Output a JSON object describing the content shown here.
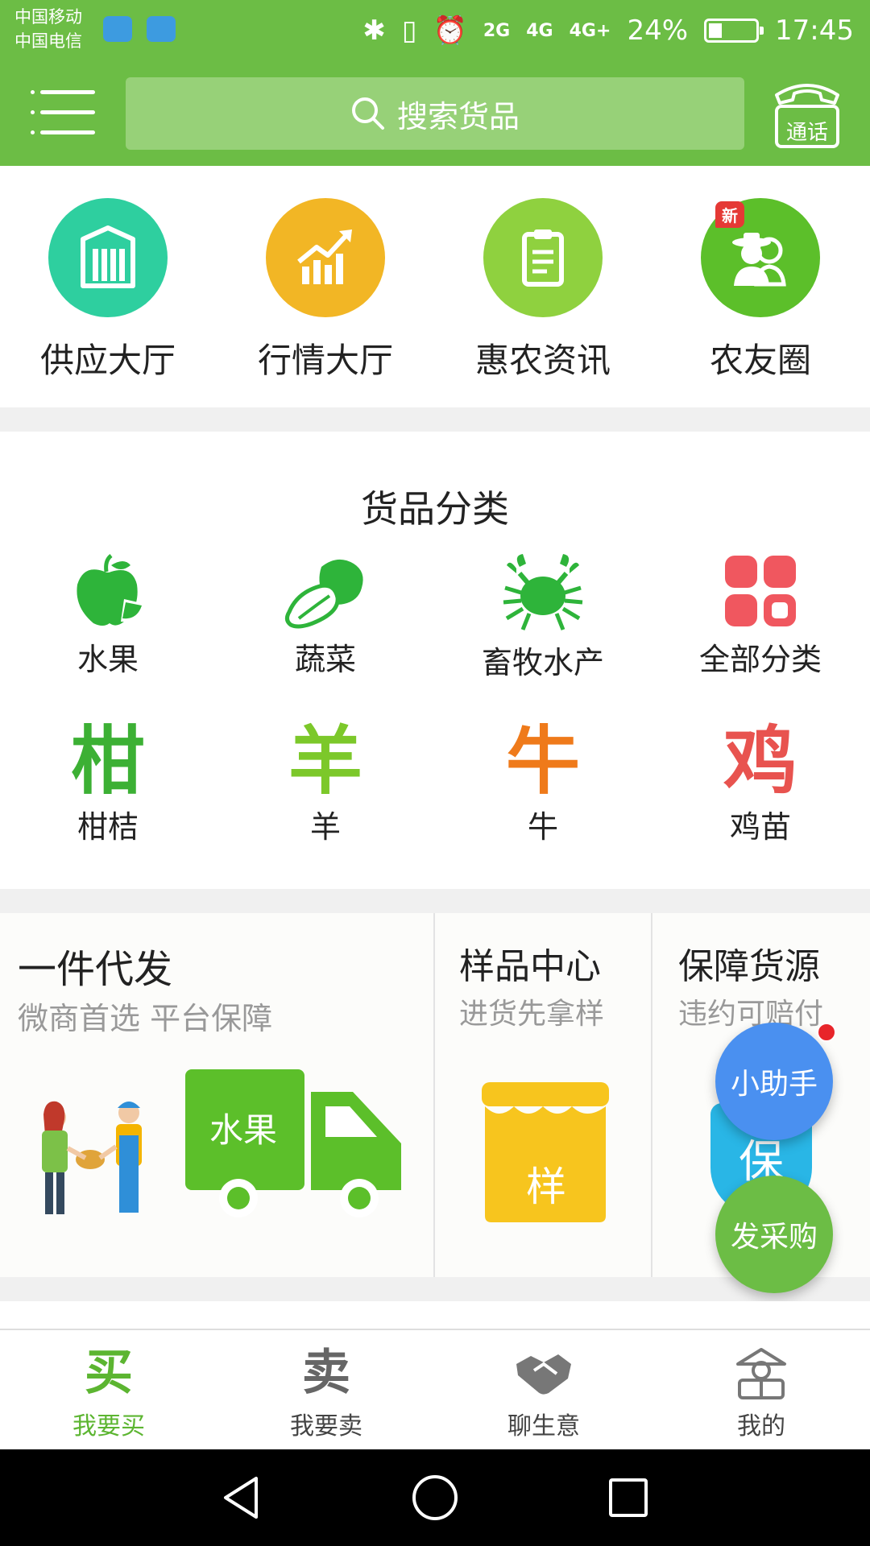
{
  "status_bar": {
    "carrier_1": "中国移动",
    "carrier_2": "中国电信",
    "net_2g": "2G",
    "net_4g": "4G",
    "net_4g_plus": "4G+",
    "net_2g_small": "2G",
    "battery": "24%",
    "time": "17:45"
  },
  "header": {
    "search_placeholder": "搜索货品",
    "call_label": "通话"
  },
  "quick_nav": [
    {
      "label": "供应大厅",
      "icon": "warehouse-icon",
      "color": "#2ecf9f"
    },
    {
      "label": "行情大厅",
      "icon": "trend-chart-icon",
      "color": "#f2b625"
    },
    {
      "label": "惠农资讯",
      "icon": "clipboard-icon",
      "color": "#8fd13f"
    },
    {
      "label": "农友圈",
      "icon": "farmer-friends-icon",
      "color": "#5cbf2a",
      "badge": "新"
    }
  ],
  "categories": {
    "title": "货品分类",
    "icon_items": [
      {
        "label": "水果",
        "icon": "apple-icon"
      },
      {
        "label": "蔬菜",
        "icon": "cabbage-icon"
      },
      {
        "label": "畜牧水产",
        "icon": "crab-icon"
      },
      {
        "label": "全部分类",
        "icon": "all-categories-icon"
      }
    ],
    "text_items": [
      {
        "char": "柑",
        "label": "柑桔",
        "color": "#3cb034"
      },
      {
        "char": "羊",
        "label": "羊",
        "color": "#7cc82a"
      },
      {
        "char": "牛",
        "label": "牛",
        "color": "#ef7a1a"
      },
      {
        "char": "鸡",
        "label": "鸡苗",
        "color": "#e8534f"
      }
    ]
  },
  "promos": {
    "dropship": {
      "title": "一件代发",
      "subtitle": "微商首选  平台保障",
      "truck_label": "水果"
    },
    "sample": {
      "title": "样品中心",
      "subtitle": "进货先拿样",
      "jar_label": "样"
    },
    "guarantee": {
      "title": "保障货源",
      "subtitle": "违约可赔付",
      "shield_label": "保"
    }
  },
  "floating": {
    "assistant": "小助手",
    "purchase": "发采购"
  },
  "tabs": [
    {
      "char": "买",
      "label": "我要买",
      "active": true
    },
    {
      "char": "卖",
      "label": "我要卖",
      "active": false
    },
    {
      "char": "",
      "label": "聊生意",
      "active": false
    },
    {
      "char": "",
      "label": "我的",
      "active": false
    }
  ],
  "colors": {
    "brand_green": "#6cbd45",
    "search_bg": "#97d178",
    "assistant_blue": "#4a90f0",
    "purchase_green": "#6cbd45",
    "active_tab": "#5cb531",
    "inactive_tab": "#666666"
  }
}
